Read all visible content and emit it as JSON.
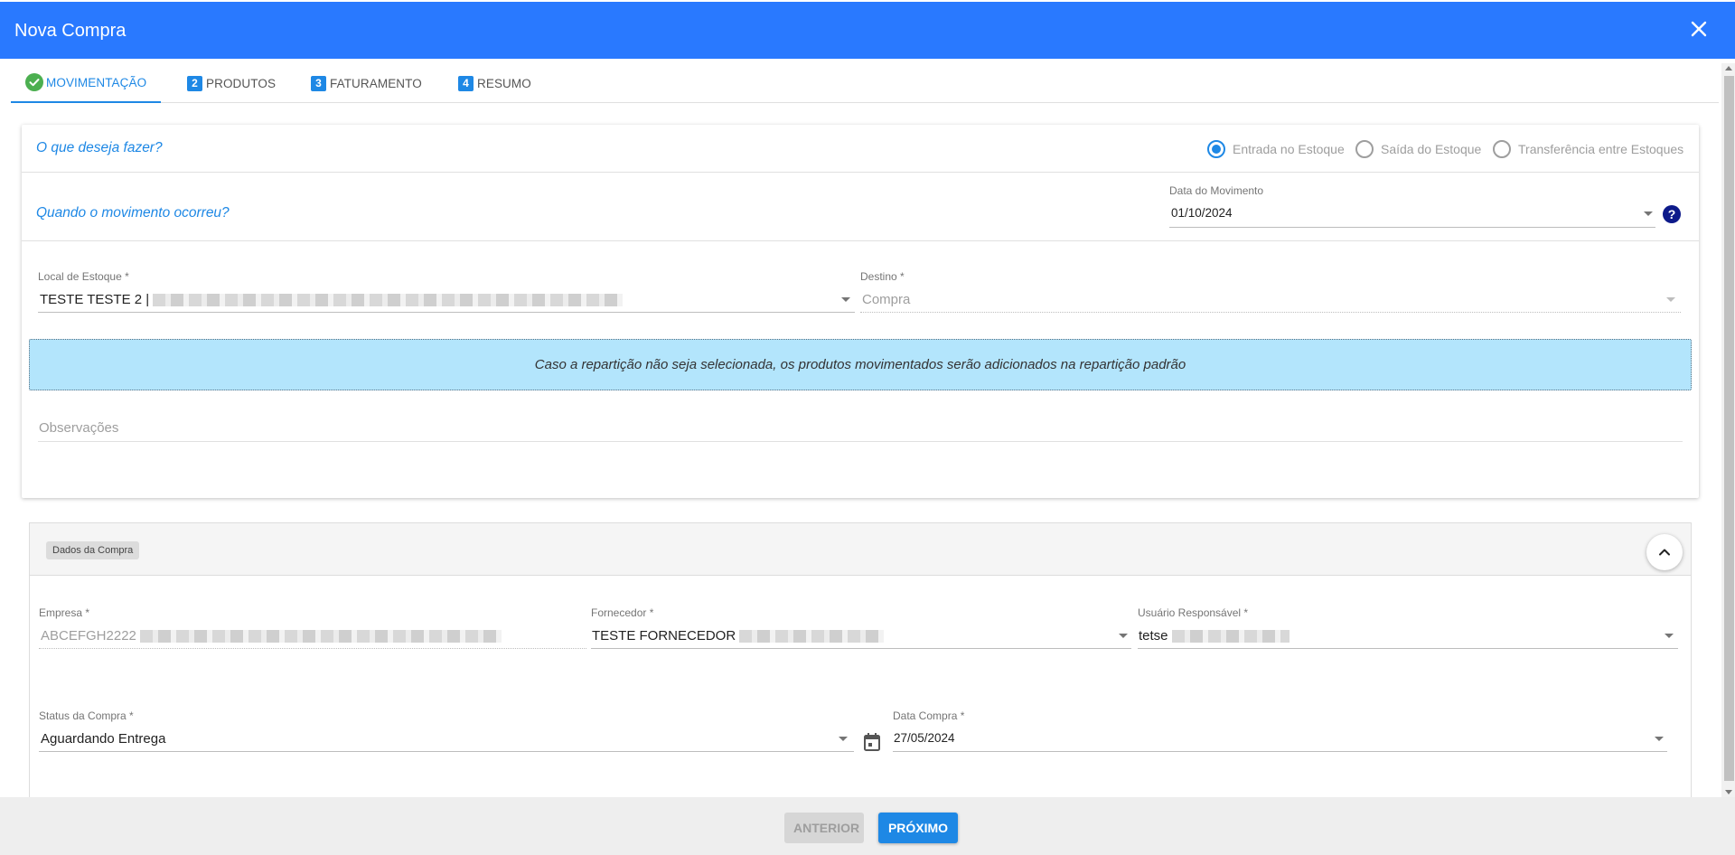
{
  "window": {
    "title": "Nova Compra"
  },
  "tabs": [
    {
      "label": "MOVIMENTAÇÃO",
      "badge": ""
    },
    {
      "label": "PRODUTOS",
      "badge": "2"
    },
    {
      "label": "FATURAMENTO",
      "badge": "3"
    },
    {
      "label": "RESUMO",
      "badge": "4"
    }
  ],
  "movement": {
    "question": "O que deseja fazer?",
    "options": [
      "Entrada no Estoque",
      "Saída do Estoque",
      "Transferência entre Estoques"
    ],
    "selected_option": "Entrada no Estoque"
  },
  "when": {
    "question": "Quando o movimento ocorreu?",
    "date_label": "Data do Movimento",
    "date_value": "01/10/2024",
    "help_glyph": "?"
  },
  "stock": {
    "local_label": "Local de Estoque *",
    "local_value": "TESTE TESTE 2 |",
    "destino_label": "Destino *",
    "destino_placeholder": "Compra"
  },
  "info_message": "Caso a repartição não seja selecionada, os produtos movimentados serão adicionados na repartição padrão",
  "observacoes_placeholder": "Observações",
  "purchase": {
    "section_label": "Dados da Compra",
    "empresa_label": "Empresa *",
    "empresa_value": "ABCEFGH2222",
    "fornecedor_label": "Fornecedor *",
    "fornecedor_value": "TESTE FORNECEDOR",
    "usuario_label": "Usuário Responsável *",
    "usuario_value": "tetse",
    "status_label": "Status da Compra *",
    "status_value": "Aguardando Entrega",
    "data_label": "Data Compra *",
    "data_value": "27/05/2024"
  },
  "footer": {
    "prev_label": "ANTERIOR",
    "next_label": "PRÓXIMO"
  },
  "colors": {
    "primary": "#2979ff",
    "accent": "#1e88e5",
    "info_bg": "#b3e5fc",
    "success": "#4caf50"
  }
}
